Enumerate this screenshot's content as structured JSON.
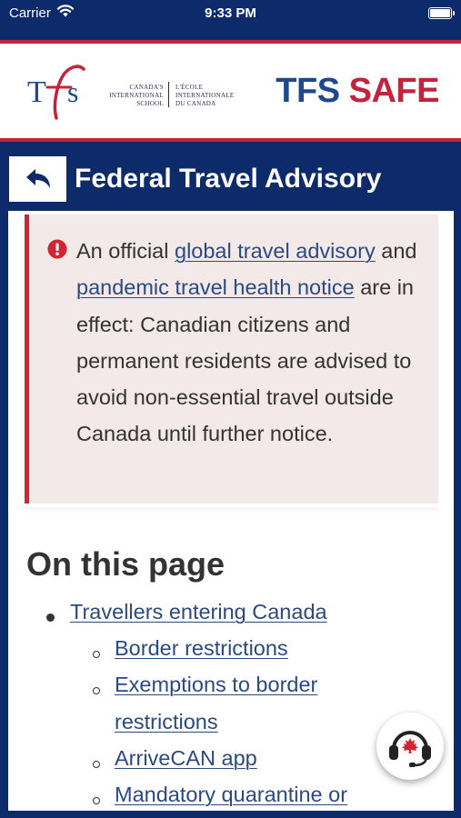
{
  "status_bar": {
    "carrier": "Carrier",
    "time": "9:33 PM"
  },
  "header": {
    "logo_letters": "Tfs",
    "school_en": [
      "CANADA'S",
      "INTERNATIONAL",
      "SCHOOL"
    ],
    "school_fr": [
      "L'ÉCOLE",
      "INTERNATIONALE",
      "DU CANADA"
    ],
    "brand_part1": "TFS",
    "brand_part2": "SAFE"
  },
  "title_bar": {
    "title": "Federal Travel Advisory"
  },
  "alert": {
    "text_1": "An official ",
    "link_1": "global travel advisory",
    "text_2": " and ",
    "link_2": "pandemic travel health notice",
    "text_3": " are in effect: Canadian citizens and permanent residents are advised to avoid non-essential travel outside Canada until further notice."
  },
  "section": {
    "title": "On this page",
    "toc": [
      {
        "level": 1,
        "label": "Travellers entering Canada"
      },
      {
        "level": 2,
        "label": "Border restrictions"
      },
      {
        "level": 2,
        "label_lines": [
          "Exemptions to border",
          "restrictions"
        ]
      },
      {
        "level": 2,
        "label": "ArriveCAN app"
      },
      {
        "level": 2,
        "label": "Mandatory quarantine or"
      }
    ]
  },
  "colors": {
    "navy": "#0d2b6b",
    "red": "#c3243d",
    "link": "#2b4a80",
    "alert_bg": "#f3e9e8"
  },
  "icons": {
    "back": "back-arrow-icon",
    "alert": "exclamation-circle-icon",
    "support": "support-headset-icon"
  }
}
